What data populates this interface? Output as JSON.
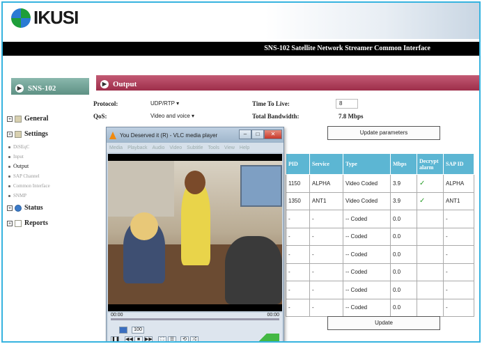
{
  "header": {
    "logo_text": "IKUSI",
    "title": "SNS-102 Satellite Network Streamer Common Interface"
  },
  "nav": {
    "device": "SNS-102",
    "items": [
      {
        "label": "General",
        "type": "main"
      },
      {
        "label": "Settings",
        "type": "main"
      },
      {
        "label": "DiSEqC",
        "type": "sub"
      },
      {
        "label": "Input",
        "type": "sub"
      },
      {
        "label": "Output",
        "type": "sub",
        "active": true
      },
      {
        "label": "SAP Channel",
        "type": "sub"
      },
      {
        "label": "Common Interface",
        "type": "sub"
      },
      {
        "label": "SNMP",
        "type": "sub"
      },
      {
        "label": "Status",
        "type": "main"
      },
      {
        "label": "Reports",
        "type": "main"
      }
    ]
  },
  "output": {
    "title": "Output",
    "protocol_label": "Protocol:",
    "protocol_value": "UDP/RTP",
    "qos_label": "QoS:",
    "qos_value": "Video and voice",
    "ttl_label": "Time To Live:",
    "ttl_value": "8",
    "bw_label": "Total Bandwidth:",
    "bw_value": "7.8 Mbps",
    "update_params": "Update parameters",
    "update": "Update"
  },
  "table": {
    "columns": [
      "PID",
      "Service",
      "Type",
      "Mbps",
      "Decrypt alarm",
      "SAP ID"
    ],
    "rows": [
      [
        "1150",
        "ALPHA",
        "Video Coded",
        "3.9",
        "✓",
        "ALPHA"
      ],
      [
        "1350",
        "ANT1",
        "Video Coded",
        "3.9",
        "✓",
        "ANT1"
      ],
      [
        "-",
        "-",
        "-- Coded",
        "0.0",
        "",
        "-"
      ],
      [
        "-",
        "-",
        "-- Coded",
        "0.0",
        "",
        "-"
      ],
      [
        "-",
        "-",
        "-- Coded",
        "0.0",
        "",
        "-"
      ],
      [
        "-",
        "-",
        "-- Coded",
        "0.0",
        "",
        "-"
      ],
      [
        "-",
        "-",
        "-- Coded",
        "0.0",
        "",
        "-"
      ],
      [
        "-",
        "-",
        "-- Coded",
        "0.0",
        "",
        "-"
      ]
    ]
  },
  "vlc": {
    "title": "You Deserved it (R) - VLC media player",
    "menu": [
      "Media",
      "Playback",
      "Audio",
      "Video",
      "Subtitle",
      "Tools",
      "View",
      "Help"
    ],
    "time_start": "00:00",
    "time_end": "00:00",
    "volume": "100"
  }
}
